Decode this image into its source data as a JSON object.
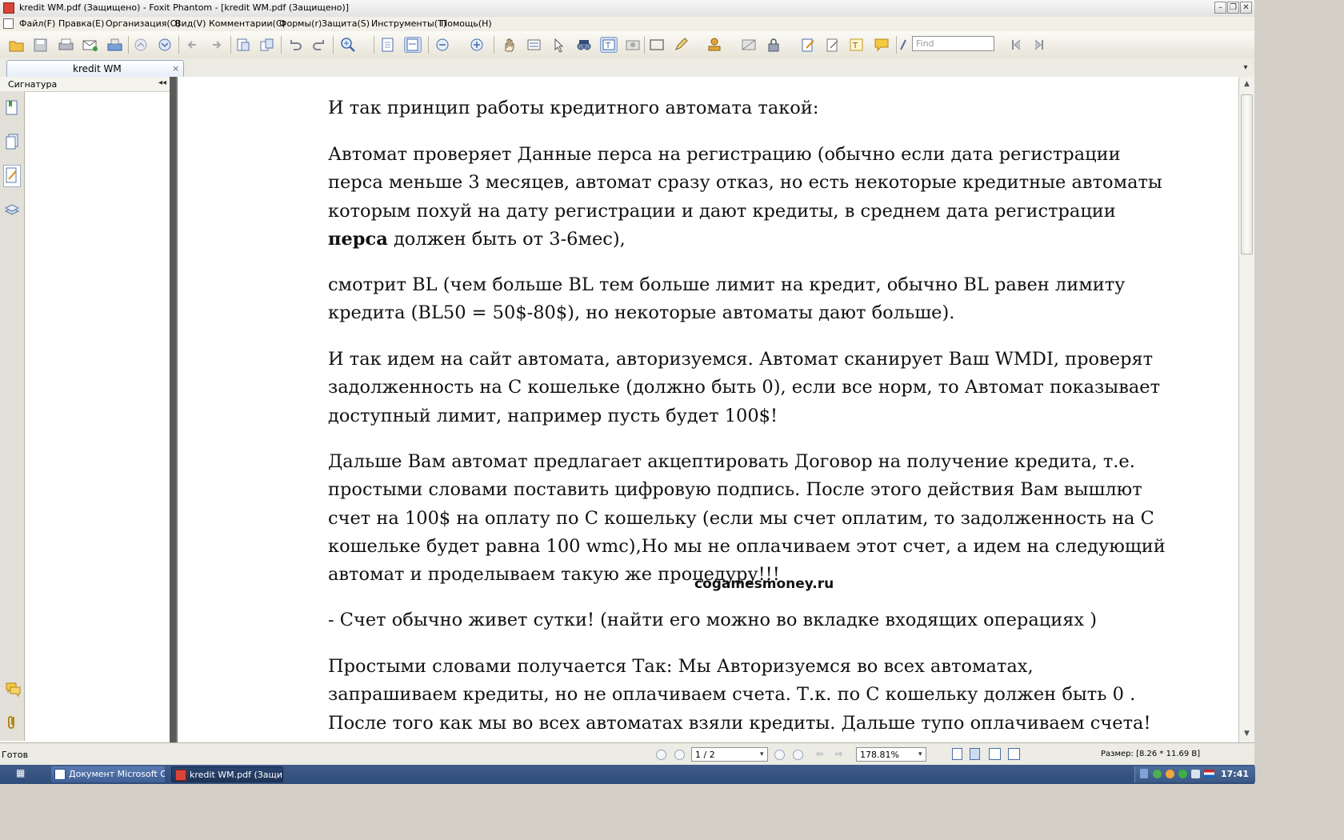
{
  "window": {
    "title": "kredit WM.pdf (Защищено) - Foxit Phantom - [kredit WM.pdf (Защищено)]"
  },
  "menu": [
    "Файл(F)",
    "Правка(E)",
    "Организация(O)",
    "Вид(V)",
    "Комментарии(C)",
    "Формы(r)",
    "Защита(S)",
    "Инструменты(T)",
    "Помощь(H)"
  ],
  "toolbar": {
    "find_placeholder": "Find"
  },
  "tab": {
    "label": "kredit WM",
    "close": "×"
  },
  "left_panel": {
    "title": "Сигнатура",
    "collapse": "◂◂"
  },
  "document": {
    "p1": "И так принцип работы кредитного автомата такой:",
    "p2_a": "Автомат проверяет Данные перса на регистрацию (обычно если дата регистрации перса меньше 3 месяцев, автомат сразу отказ, но есть некоторые кредитные автоматы которым похуй на дату регистрации и дают кредиты, в среднем дата регистрации ",
    "p2_bold": "перса",
    "p2_b": " должен быть от 3-6мес),",
    "p3": "смотрит BL (чем больше BL тем больше лимит на кредит, обычно BL равен лимиту кредита (BL50 = 50$-80$), но некоторые автоматы дают больше).",
    "p4": "И так идем на сайт автомата, авторизуемся. Автомат сканирует Ваш WMDI, проверят задолженность на С кошельке (должно быть 0), если все норм, то Автомат показывает доступный лимит, например пусть будет 100$!",
    "p5": "Дальше Вам автомат предлагает акцептировать Договор на получение кредита, т.е. простыми словами поставить цифровую подпись. После этого действия Вам вышлют счет на 100$ на оплату по С кошельку (если мы счет оплатим, то задолженность на С кошельке будет равна 100 wmc),Но мы не оплачиваем этот счет, а идем на следующий автомат и проделываем такую же процедуру!!!",
    "watermark": "cogamesmoney.ru",
    "p6": "- Счет обычно живет сутки! (найти его можно во вкладке входящих операциях )",
    "p7": "Простыми словами получается Так:  Мы Авторизуемся во всех автоматах, запрашиваем кредиты, но не оплачиваем счета. Т.к.  по С кошельку должен быть  0 . После того как мы во всех автоматах взяли кредиты. Дальше тупо оплачиваем счета!"
  },
  "status": {
    "ready": "Готов",
    "page": "1 / 2",
    "zoom": "178.81%",
    "size": "Размер: [8.26 * 11.69 В]"
  },
  "taskbar": {
    "tasks": [
      "Документ Microsoft О...",
      "kredit WM.pdf (Защи..."
    ],
    "clock": "17:41"
  },
  "colors": {
    "taskbar": "#2f4d79",
    "pdf_icon": "#d8443a",
    "doc_bg": "#787878"
  }
}
